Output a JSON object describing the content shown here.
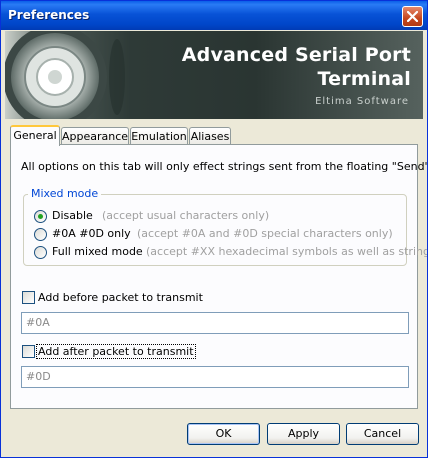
{
  "window": {
    "title": "Preferences"
  },
  "banner": {
    "title_line1": "Advanced Serial Port",
    "title_line2": "Terminal",
    "vendor": "Eltima Software"
  },
  "tabs": [
    {
      "label": "General",
      "active": true
    },
    {
      "label": "Appearance",
      "active": false
    },
    {
      "label": "Emulation",
      "active": false
    },
    {
      "label": "Aliases",
      "active": false
    }
  ],
  "general": {
    "info_text": "All options on this tab will only effect strings sent from the floating \"Send\" dialog.",
    "mixed_mode": {
      "title": "Mixed mode",
      "options": [
        {
          "label": "Disable",
          "hint": "(accept usual characters only)",
          "selected": true
        },
        {
          "label": "#0A #0D only",
          "hint": "(accept #0A and #0D special characters only)",
          "selected": false
        },
        {
          "label": "Full mixed mode",
          "hint": "(accept #XX hexadecimal symbols as well as strings)",
          "selected": false
        }
      ]
    },
    "before_packet": {
      "label": "Add before packet to transmit",
      "checked": false,
      "value": "#0A"
    },
    "after_packet": {
      "label": "Add after packet to transmit",
      "checked": false,
      "value": "#0D"
    }
  },
  "buttons": {
    "ok": "OK",
    "apply": "Apply",
    "cancel": "Cancel"
  },
  "colors": {
    "titlebar": "#0853d7",
    "accent": "#0046d5",
    "radio_selected": "#21a121",
    "tab_highlight": "#ffc83c"
  },
  "icons": {
    "close": "close-icon",
    "logo": "speaker-logo-icon"
  }
}
